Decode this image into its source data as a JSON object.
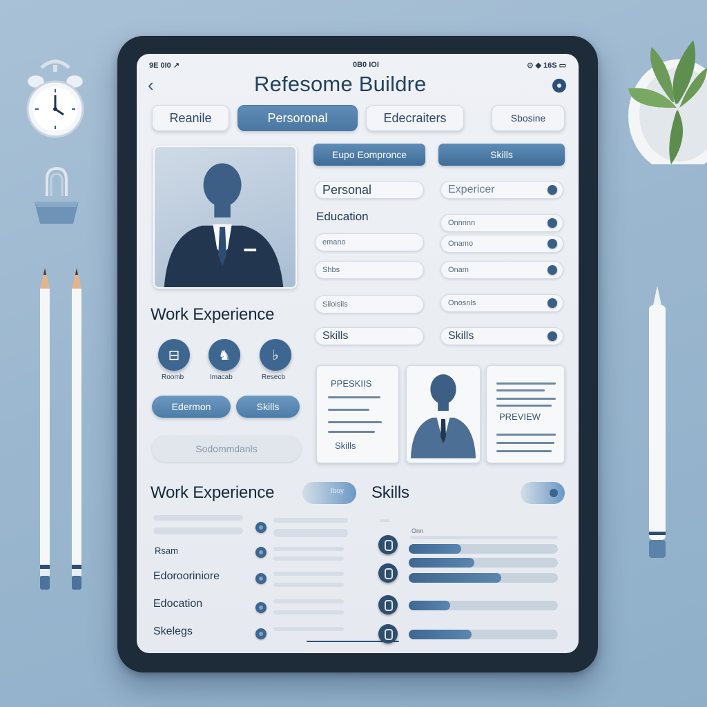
{
  "status_bar": {
    "left": "9E 0I0 ↗",
    "center": "0B0 IOI",
    "right": "⊙ ◆ 16S ▭"
  },
  "header": {
    "title": "Refesome Buildre"
  },
  "tabs": [
    {
      "label": "Reanile",
      "active": false
    },
    {
      "label": "Persoronal",
      "active": true
    },
    {
      "label": "Edecraiters",
      "active": false
    },
    {
      "label": "Sbosine",
      "active": false
    }
  ],
  "chips": {
    "experience": "Eupo Eompronce",
    "skills": "Skills"
  },
  "form": {
    "personal_label": "Personal",
    "experience_placeholder": "Expericer",
    "education_label": "Education",
    "rows_left": [
      "",
      "emano",
      "Shbs",
      "Siloisils",
      "Skills"
    ],
    "rows_right": [
      "Onnnnn",
      "Onamo",
      "Onam",
      "Onosnls",
      "Skills"
    ]
  },
  "work_experience_title": "Work Experience",
  "round_icons": [
    {
      "glyph": "⊟",
      "caption": "Roomb"
    },
    {
      "glyph": "♞",
      "caption": "Imacab"
    },
    {
      "glyph": "♭",
      "caption": "Resecb"
    }
  ],
  "pills": {
    "edermon": "Edermon",
    "skills": "Skills",
    "ghost": "Sodommdanls"
  },
  "preview_cards": {
    "left_title": "PPESKIIS",
    "left_sub": "Skills",
    "right_title": "PREVIEW"
  },
  "bottom": {
    "work_title": "Work Experience",
    "work_toggle": "Iboy",
    "skills_title": "Skills",
    "labels": [
      "Rsam",
      "Edorooriniore",
      "Edocation",
      "Skelegs"
    ],
    "skills_caption": "Onn",
    "skill_levels": [
      0.35,
      0.44,
      0.62,
      0.28,
      0.42
    ]
  },
  "colors": {
    "accent": "#4a78a3",
    "dark": "#1e2b38",
    "background": "#9bb7cf"
  },
  "icons": [
    "back-chevron-icon",
    "menu-icon",
    "alarm-clock-icon",
    "binder-clip-icon",
    "pencil-icon",
    "pen-icon",
    "plant-icon",
    "person-silhouette-icon"
  ]
}
